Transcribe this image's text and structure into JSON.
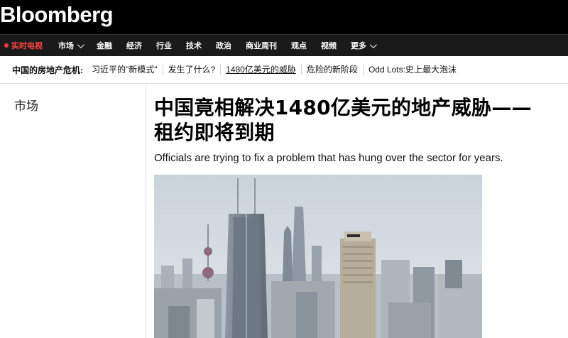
{
  "masthead": {
    "logo": "Bloomberg"
  },
  "nav": {
    "live_tv": "实时电视",
    "items": [
      {
        "label": "市场",
        "has_menu": true
      },
      {
        "label": "金融"
      },
      {
        "label": "经济"
      },
      {
        "label": "行业"
      },
      {
        "label": "技术"
      },
      {
        "label": "政治"
      },
      {
        "label": "商业周刊"
      },
      {
        "label": "观点"
      },
      {
        "label": "视频"
      },
      {
        "label": "更多",
        "has_menu": true
      }
    ]
  },
  "topics": {
    "label": "中国的房地产危机:",
    "links": [
      "习近平的\"新模式\"",
      "发生了什么?",
      "1480亿美元的威胁",
      "危险的新阶段",
      "Odd Lots:史上最大泡沫"
    ],
    "active_index": 2
  },
  "article": {
    "section": "市场",
    "headline_line1": "中国竟相解决1480亿美元的地产威胁——",
    "headline_line2": "租约即将到期",
    "dek": "Officials are trying to fix a problem that has hung over the sector for years."
  },
  "colors": {
    "masthead_bg": "#000000",
    "live_red": "#ff3b3b",
    "nav_bg": "#1a1a1a"
  }
}
